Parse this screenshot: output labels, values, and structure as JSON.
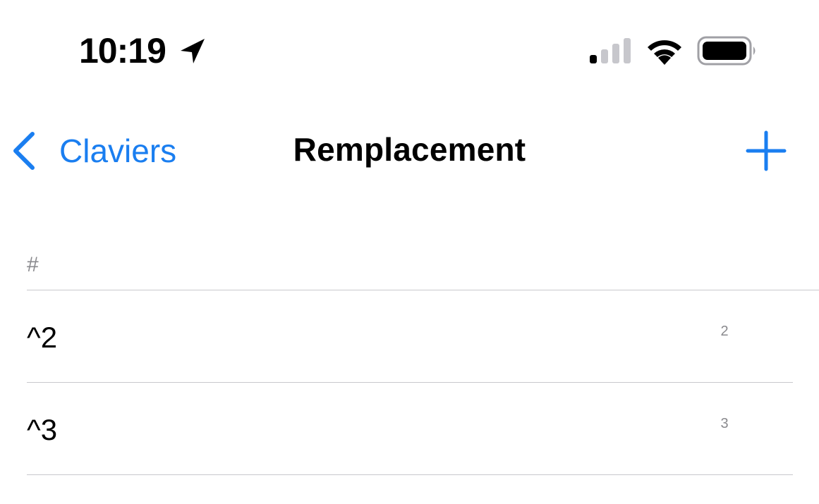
{
  "status_bar": {
    "time": "10:19",
    "icons": [
      "location-arrow-icon",
      "cellular-signal-icon",
      "wifi-icon",
      "battery-icon"
    ]
  },
  "nav": {
    "back_label": "Claviers",
    "title": "Remplacement",
    "add_icon": "plus-icon"
  },
  "section": {
    "header": "#"
  },
  "rows": [
    {
      "phrase": "^2",
      "shortcut": "2"
    },
    {
      "phrase": "^3",
      "shortcut": "3"
    }
  ],
  "colors": {
    "accent": "#1a7ef0",
    "secondary_text": "#8a8a8e",
    "separator": "#c8c8cc"
  }
}
